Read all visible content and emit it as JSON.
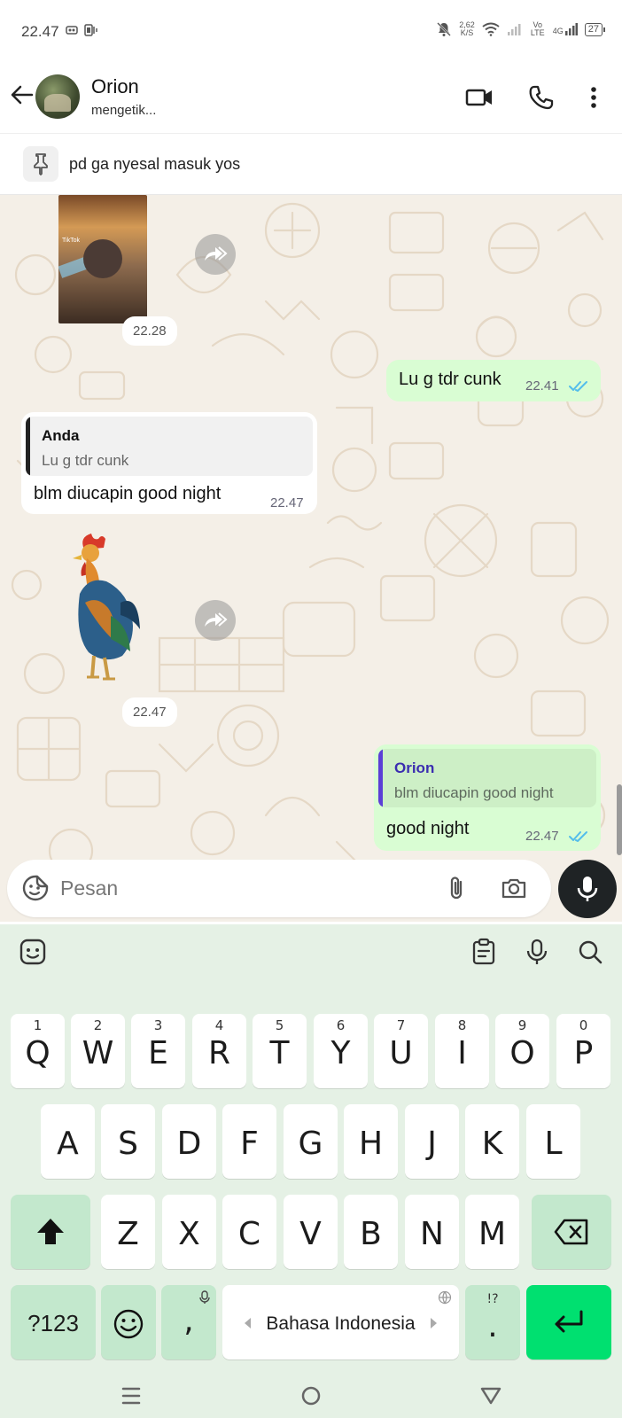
{
  "status_bar": {
    "time": "22.47",
    "net_speed_value": "2,62",
    "net_speed_unit": "K/S",
    "volte": "Vo LTE",
    "network": "4G",
    "battery": "27"
  },
  "header": {
    "contact_name": "Orion",
    "status": "mengetik...",
    "icons": [
      "back-arrow-icon",
      "video-call-icon",
      "voice-call-icon",
      "more-options-icon"
    ]
  },
  "pinned": {
    "text": "pd ga nyesal masuk yos"
  },
  "messages": {
    "m1": {
      "type": "video",
      "time": "22.28",
      "thumb_label": "TikTok"
    },
    "m2": {
      "type": "text",
      "direction": "out",
      "text": "Lu g tdr cunk",
      "time": "22.41"
    },
    "m3": {
      "type": "reply",
      "direction": "in",
      "quote_name": "Anda",
      "quote_text": "Lu g tdr cunk",
      "text": "blm diucapin good night",
      "time": "22.47"
    },
    "m4": {
      "type": "sticker",
      "time": "22.47"
    },
    "m5": {
      "type": "reply",
      "direction": "out",
      "quote_name": "Orion",
      "quote_text": "blm diucapin good night",
      "text": "good night",
      "time": "22.47"
    }
  },
  "composer": {
    "placeholder": "Pesan"
  },
  "keyboard": {
    "row1": [
      {
        "l": "Q",
        "n": "1"
      },
      {
        "l": "W",
        "n": "2"
      },
      {
        "l": "E",
        "n": "3"
      },
      {
        "l": "R",
        "n": "4"
      },
      {
        "l": "T",
        "n": "5"
      },
      {
        "l": "Y",
        "n": "6"
      },
      {
        "l": "U",
        "n": "7"
      },
      {
        "l": "I",
        "n": "8"
      },
      {
        "l": "O",
        "n": "9"
      },
      {
        "l": "P",
        "n": "0"
      }
    ],
    "row2": [
      "A",
      "S",
      "D",
      "F",
      "G",
      "H",
      "J",
      "K",
      "L"
    ],
    "row3": [
      "Z",
      "X",
      "C",
      "V",
      "B",
      "N",
      "M"
    ],
    "sym_key": "?123",
    "comma": ",",
    "space_label": "Bahasa Indonesia",
    "period": ".",
    "period_hint": "!?"
  },
  "colors": {
    "outgoing_bubble": "#d9fdd3",
    "incoming_bubble": "#ffffff",
    "chat_bg": "#f4efe7",
    "keyboard_bg": "#e5f1e5",
    "enter_key": "#00e070",
    "tick_blue": "#53bdeb"
  }
}
